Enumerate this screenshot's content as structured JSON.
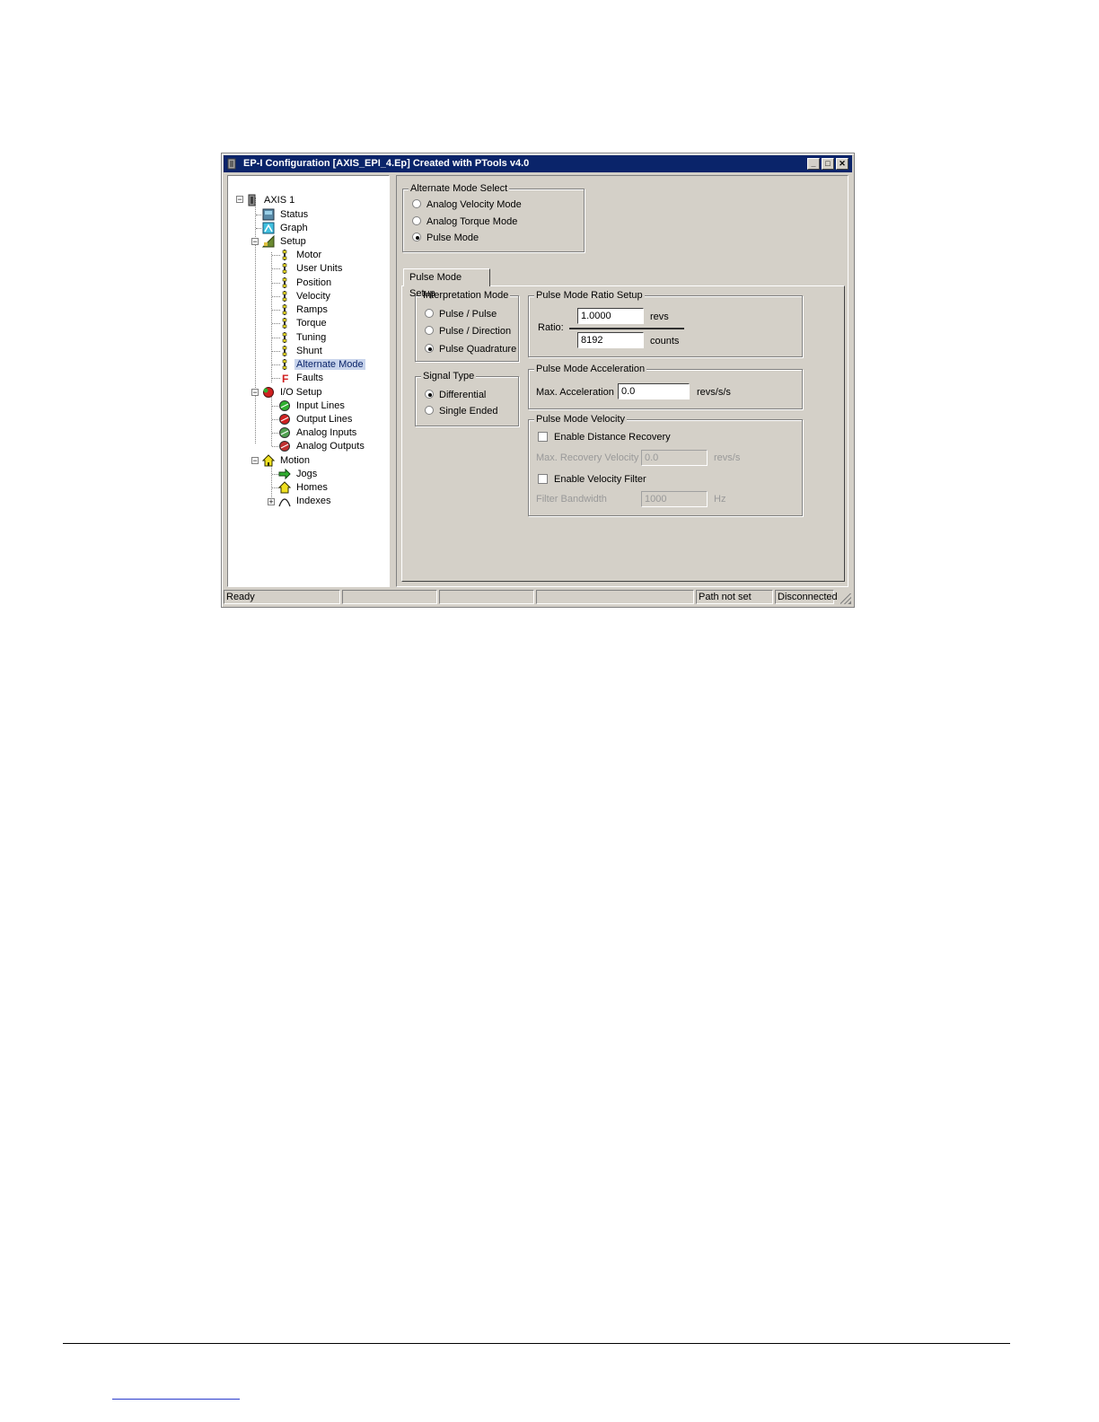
{
  "window": {
    "title": "EP-I Configuration  [AXIS_EPI_4.Ep] Created with PTools v4.0",
    "buttons": {
      "minimize": "_",
      "maximize": "□",
      "close": "✕"
    }
  },
  "tree": {
    "root": "AXIS 1",
    "items": {
      "status": "Status",
      "graph": "Graph",
      "setup": "Setup",
      "motor": "Motor",
      "user_units": "User Units",
      "position": "Position",
      "velocity": "Velocity",
      "ramps": "Ramps",
      "torque": "Torque",
      "tuning": "Tuning",
      "shunt": "Shunt",
      "alternate_mode": "Alternate Mode",
      "faults": "Faults",
      "io_setup": "I/O Setup",
      "input_lines": "Input Lines",
      "output_lines": "Output Lines",
      "analog_inputs": "Analog Inputs",
      "analog_outputs": "Analog Outputs",
      "motion": "Motion",
      "jogs": "Jogs",
      "homes": "Homes",
      "indexes": "Indexes"
    },
    "selected": "alternate_mode",
    "faults_glyph": "F"
  },
  "alternate_mode_select": {
    "title": "Alternate Mode Select",
    "options": [
      "Analog Velocity Mode",
      "Analog Torque Mode",
      "Pulse Mode"
    ],
    "selected_index": 2
  },
  "tab": {
    "label": "Pulse Mode Setup"
  },
  "interpretation_mode": {
    "title": "Interpretation Mode",
    "options": [
      "Pulse / Pulse",
      "Pulse / Direction",
      "Pulse Quadrature"
    ],
    "selected_index": 2
  },
  "signal_type": {
    "title": "Signal Type",
    "options": [
      "Differential",
      "Single Ended"
    ],
    "selected_index": 0
  },
  "ratio_setup": {
    "title": "Pulse Mode Ratio Setup",
    "ratio_label": "Ratio:",
    "numerator": "1.0000",
    "numerator_unit": "revs",
    "denominator": "8192",
    "denominator_unit": "counts"
  },
  "acceleration": {
    "title": "Pulse Mode Acceleration",
    "label": "Max. Acceleration",
    "value": "0.0",
    "unit": "revs/s/s"
  },
  "velocity": {
    "title": "Pulse Mode Velocity",
    "enable_distance_recovery": "Enable Distance Recovery",
    "max_recovery_label": "Max. Recovery Velocity",
    "max_recovery_value": "0.0",
    "max_recovery_unit": "revs/s",
    "enable_velocity_filter": "Enable Velocity Filter",
    "filter_bandwidth_label": "Filter Bandwidth",
    "filter_bandwidth_value": "1000",
    "filter_bandwidth_unit": "Hz"
  },
  "status_bar": {
    "ready": "Ready",
    "path": "Path not set",
    "connection": "Disconnected"
  }
}
